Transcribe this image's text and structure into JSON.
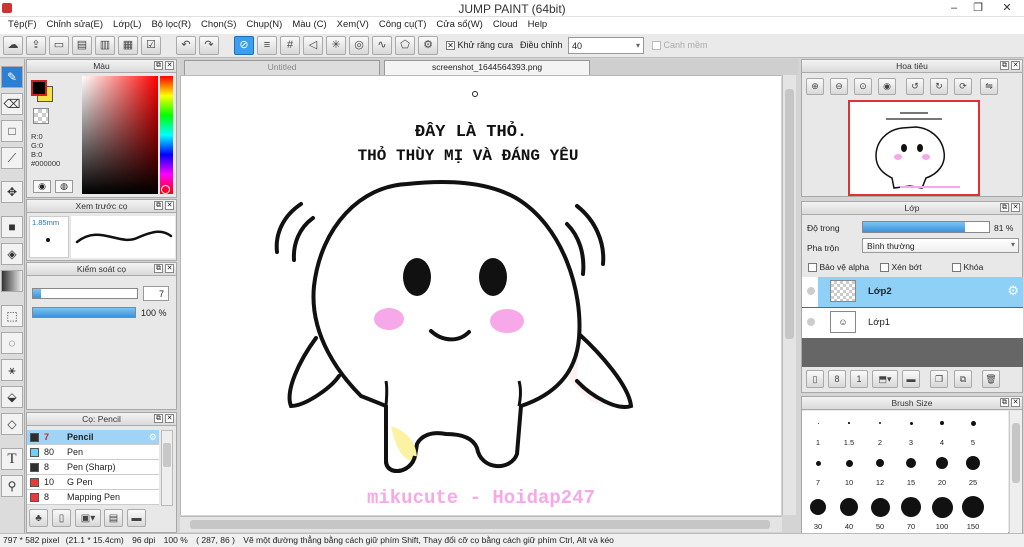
{
  "window": {
    "title": "JUMP PAINT (64bit)"
  },
  "menu": [
    "Tệp(F)",
    "Chỉnh sửa(E)",
    "Lớp(L)",
    "Bộ lọc(R)",
    "Chọn(S)",
    "Chụp(N)",
    "Màu (C)",
    "Xem(V)",
    "Công cụ(T)",
    "Cửa sổ(W)",
    "Cloud",
    "Help"
  ],
  "toolbar": {
    "antialias_label": "Khử răng cưa",
    "adjust_label": "Điều chỉnh",
    "adjust_value": "40",
    "margin_label": "Canh mềm"
  },
  "color_panel": {
    "title": "Màu",
    "r": "R:0",
    "g": "G:0",
    "b": "B:0",
    "hex": "#000000",
    "primary": "#000000",
    "secondary": "#f5e24a"
  },
  "brush_preview": {
    "title": "Xem trước cọ",
    "size": "1.85mm"
  },
  "brush_control": {
    "title": "Kiểm soát cọ",
    "size_value": "7",
    "size_fraction": 0.08,
    "opacity_value": "100 %",
    "opacity_fraction": 1.0
  },
  "brush_list": {
    "title": "Cọ: Pencil",
    "items": [
      {
        "size": "7",
        "name": "Pencil",
        "color": "#2e2e2e"
      },
      {
        "size": "80",
        "name": "Pen",
        "color": "#6fd0f5"
      },
      {
        "size": "8",
        "name": "Pen (Sharp)",
        "color": "#2e2e2e"
      },
      {
        "size": "10",
        "name": "G Pen",
        "color": "#e83a3a"
      },
      {
        "size": "8",
        "name": "Mapping Pen",
        "color": "#e83a3a"
      }
    ]
  },
  "tabs": [
    "Untitled",
    "screenshot_1644564393.png"
  ],
  "drawing": {
    "line1": "ĐÂY LÀ THỎ.",
    "line2": "THỎ THÙY MỊ VÀ ĐÁNG YÊU",
    "watermark": "mikucute - Hoidap247"
  },
  "navigator": {
    "title": "Hoa tiêu"
  },
  "layer_panel": {
    "title": "Lớp",
    "opacity_label": "Độ trong",
    "opacity_value": "81 %",
    "opacity_fraction": 0.81,
    "blend_label": "Pha trộn",
    "blend_value": "Bình thường",
    "protect_alpha": "Bảo vệ alpha",
    "clip": "Xén bớt",
    "lock": "Khóa",
    "layers": [
      "Lớp2",
      "Lớp1"
    ]
  },
  "brush_size": {
    "title": "Brush Size",
    "sizes": [
      "1",
      "1.5",
      "2",
      "3",
      "4",
      "5",
      "7",
      "10",
      "12",
      "15",
      "20",
      "25",
      "30",
      "40",
      "50",
      "70",
      "100",
      "150"
    ]
  },
  "status": {
    "size": "797 * 582 pixel",
    "cm": "(21.1 * 15.4cm)",
    "dpi": "96 dpi",
    "zoom": "100 %",
    "coords": "( 287, 86 )",
    "hint": "Vẽ một đường thẳng bằng cách giữ phím Shift, Thay đổi cỡ cọ bằng cách giữ phím Ctrl, Alt và kéo"
  }
}
